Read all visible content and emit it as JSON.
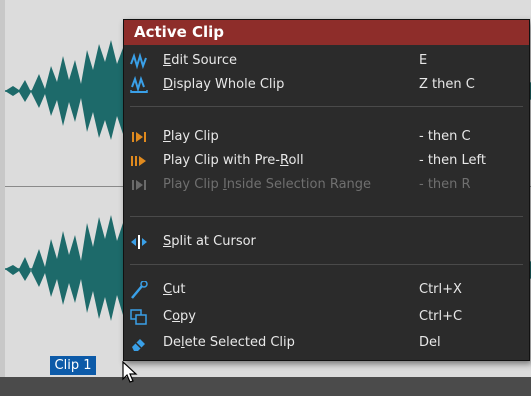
{
  "clip": {
    "label": "Clip 1"
  },
  "menu": {
    "title": "Active Clip",
    "items": [
      {
        "id": "edit-source",
        "pre": "",
        "ul": "E",
        "post": "dit Source",
        "shortcut": "E",
        "icon": "edit-source-icon",
        "disabled": false
      },
      {
        "id": "display-whole-clip",
        "pre": "",
        "ul": "D",
        "post": "isplay Whole Clip",
        "shortcut": "Z then C",
        "icon": "display-whole-clip-icon",
        "disabled": false
      },
      {
        "id": "play-clip",
        "pre": "",
        "ul": "P",
        "post": "lay Clip",
        "shortcut": "- then C",
        "icon": "play-clip-icon",
        "disabled": false
      },
      {
        "id": "play-clip-pre-roll",
        "pre": "Play Clip with Pre-",
        "ul": "R",
        "post": "oll",
        "shortcut": "- then Left",
        "icon": "play-pre-roll-icon",
        "disabled": false
      },
      {
        "id": "play-clip-selection",
        "pre": "Play Clip ",
        "ul": "I",
        "post": "nside Selection Range",
        "shortcut": "- then R",
        "icon": "play-selection-icon",
        "disabled": true
      },
      {
        "id": "split-at-cursor",
        "pre": "",
        "ul": "S",
        "post": "plit at Cursor",
        "shortcut": "",
        "icon": "split-icon",
        "disabled": false
      },
      {
        "id": "cut",
        "pre": "",
        "ul": "C",
        "post": "ut",
        "shortcut": "Ctrl+X",
        "icon": "cut-icon",
        "disabled": false
      },
      {
        "id": "copy",
        "pre": "C",
        "ul": "o",
        "post": "py",
        "shortcut": "Ctrl+C",
        "icon": "copy-icon",
        "disabled": false
      },
      {
        "id": "delete-selected-clip",
        "pre": "De",
        "ul": "l",
        "post": "ete Selected Clip",
        "shortcut": "Del",
        "icon": "eraser-icon",
        "disabled": false
      }
    ]
  },
  "colors": {
    "header": "#8e2d2a",
    "menu_bg": "#2b2b2b",
    "waveform": "#1d6a6a",
    "clip_label_bg": "#0c5aa8",
    "icon_blue": "#3aa0e8",
    "icon_orange": "#e08a1e"
  }
}
